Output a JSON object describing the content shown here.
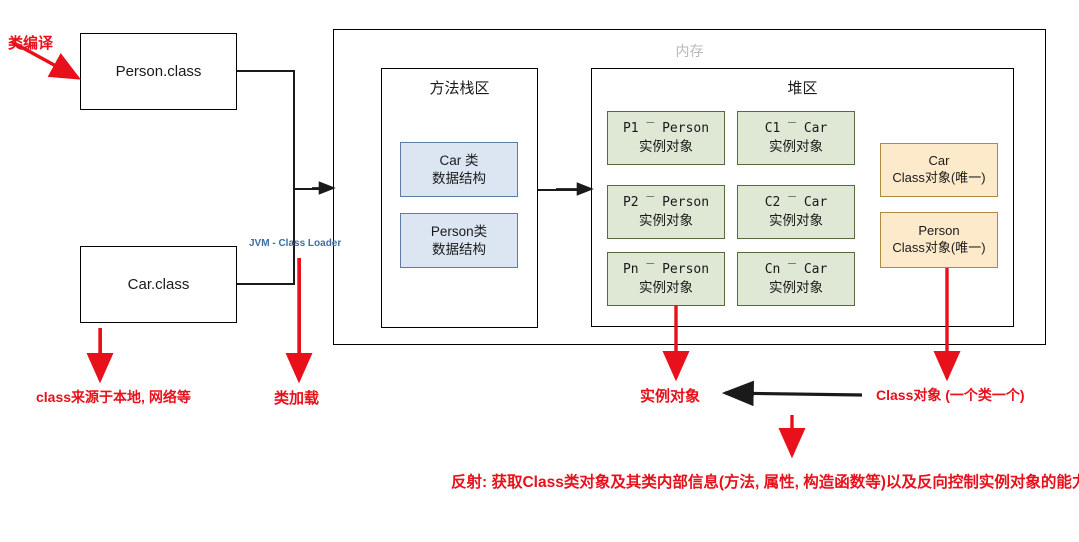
{
  "diagram": {
    "title_watermark": "内存",
    "class_files": [
      {
        "label": "Person.class"
      },
      {
        "label": "Car.class"
      }
    ],
    "jvm_label": "JVM - Class Loader",
    "method_area": {
      "title": "方法栈区",
      "items": [
        {
          "line1": "Car 类",
          "line2": "数据结构"
        },
        {
          "line1": "Person类",
          "line2": "数据结构"
        }
      ]
    },
    "heap": {
      "title": "堆区",
      "instances_col1": [
        {
          "line1": "P1 ‾ Person",
          "line2": "实例对象"
        },
        {
          "line1": "P2 ‾ Person",
          "line2": "实例对象"
        },
        {
          "line1": "Pn ‾ Person",
          "line2": "实例对象"
        }
      ],
      "instances_col2": [
        {
          "line1": "C1 ‾ Car",
          "line2": "实例对象"
        },
        {
          "line1": "C2 ‾ Car",
          "line2": "实例对象"
        },
        {
          "line1": "Cn ‾ Car",
          "line2": "实例对象"
        }
      ],
      "class_objects": [
        {
          "line1": "Car",
          "line2": "Class对象(唯一)"
        },
        {
          "line1": "Person",
          "line2": "Class对象(唯一)"
        }
      ]
    },
    "annotations": {
      "compile": "类编译",
      "class_source": "class来源于本地, 网络等",
      "class_load": "类加载",
      "instance_object": "实例对象",
      "class_object": "Class对象 (一个类一个)",
      "reflection": "反射: 获取Class类对象及其类内部信息(方法, 属性, 构造函数等)以及反向控制实例对象的能力"
    },
    "colors": {
      "red": "#e8101b",
      "blue_fill": "#dce6f2",
      "green_fill": "#dfe8d4",
      "yellow_fill": "#fdeaca",
      "jvm_blue": "#3b6ea5",
      "watermark_gray": "#b8b8b8"
    }
  }
}
